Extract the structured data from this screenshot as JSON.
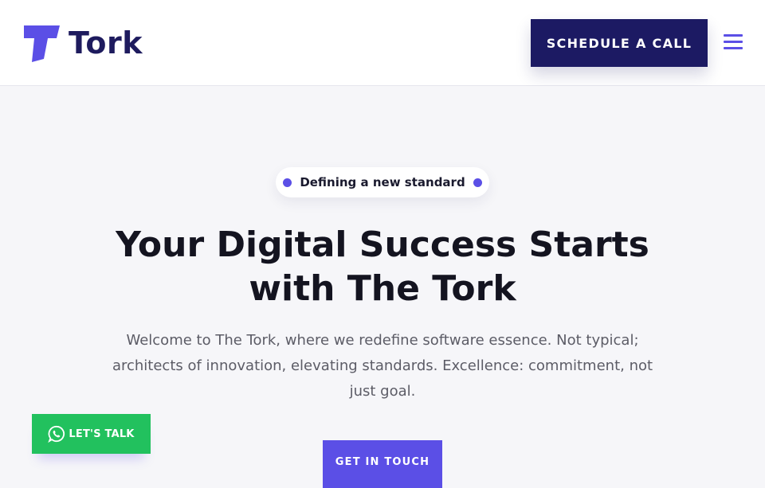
{
  "header": {
    "logo_text": "Tork",
    "cta_label": "SCHEDULE A CALL",
    "menu_icon": "hamburger-menu-icon"
  },
  "hero": {
    "badge_text": "Defining a new standard",
    "headline_line1": "Your Digital Success Starts",
    "headline_line2": "with The Tork",
    "subtext": "Welcome to The Tork, where we redefine software essence. Not typical; architects of innovation, elevating standards. Excellence: commitment, not just goal.",
    "primary_button": "GET IN TOUCH"
  },
  "floating": {
    "whatsapp_label": "LET'S TALK",
    "whatsapp_icon": "whatsapp-icon"
  },
  "colors": {
    "brand_navy": "#1c1a63",
    "brand_purple": "#5b4fe6",
    "whatsapp_green": "#22c15e",
    "background": "#f6f6f9"
  }
}
